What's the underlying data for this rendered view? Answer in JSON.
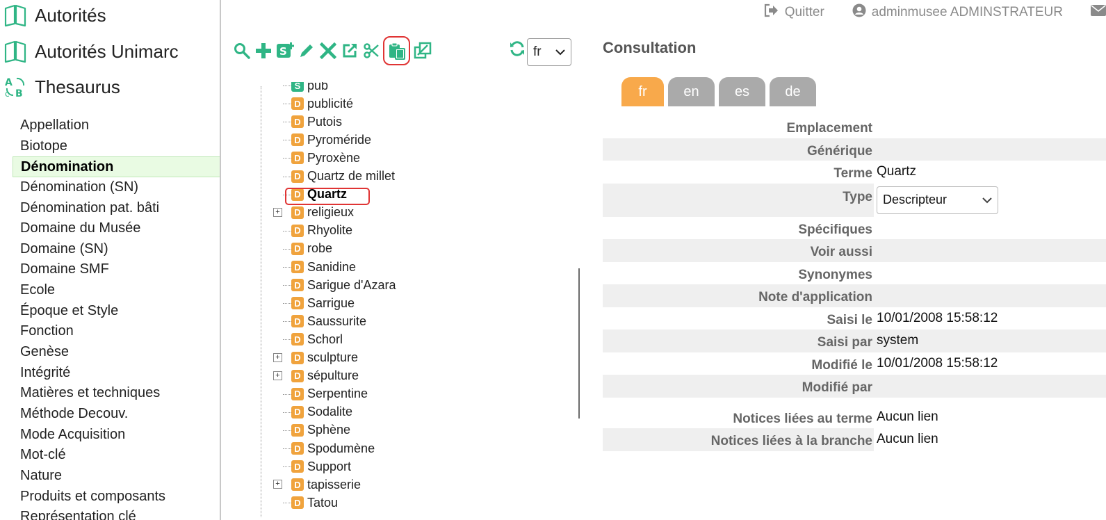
{
  "modules": [
    {
      "label": "Autorités",
      "icon": "book-icon"
    },
    {
      "label": "Autorités Unimarc",
      "icon": "book-icon"
    },
    {
      "label": "Thesaurus",
      "icon": "thesaurus-icon"
    }
  ],
  "categories": [
    "Appellation",
    "Biotope",
    "Dénomination",
    "Dénomination (SN)",
    "Dénomination pat. bâti",
    "Domaine du Musée",
    "Domaine (SN)",
    "Domaine SMF",
    "Ecole",
    "Époque et Style",
    "Fonction",
    "Genèse",
    "Intégrité",
    "Matières et techniques",
    "Méthode Decouv.",
    "Mode Acquisition",
    "Mot-clé",
    "Nature",
    "Produits et composants",
    "Représentation clé"
  ],
  "active_category": "Dénomination",
  "header": {
    "quit_label": "Quitter",
    "user_label": "adminmusee ADMINSTRATEUR"
  },
  "toolbar": {
    "icons": [
      "search-icon",
      "add-icon",
      "add-specific-icon",
      "edit-icon",
      "delete-icon",
      "open-external-icon",
      "cut-icon",
      "paste-icon",
      "link-icon"
    ],
    "highlighted": "paste-icon",
    "lang_value": "fr"
  },
  "tree": {
    "items": [
      {
        "label": "pub",
        "type": "S"
      },
      {
        "label": "publicité",
        "type": "D"
      },
      {
        "label": "Putois",
        "type": "D"
      },
      {
        "label": "Pyroméride",
        "type": "D"
      },
      {
        "label": "Pyroxène",
        "type": "D"
      },
      {
        "label": "Quartz de millet",
        "type": "D"
      },
      {
        "label": "Quartz",
        "type": "D",
        "selected": true
      },
      {
        "label": "religieux",
        "type": "D",
        "expandable": true
      },
      {
        "label": "Rhyolite",
        "type": "D"
      },
      {
        "label": "robe",
        "type": "D"
      },
      {
        "label": "Sanidine",
        "type": "D"
      },
      {
        "label": "Sarigue d'Azara",
        "type": "D"
      },
      {
        "label": "Sarrigue",
        "type": "D"
      },
      {
        "label": "Saussurite",
        "type": "D"
      },
      {
        "label": "Schorl",
        "type": "D"
      },
      {
        "label": "sculpture",
        "type": "D",
        "expandable": true
      },
      {
        "label": "sépulture",
        "type": "D",
        "expandable": true
      },
      {
        "label": "Serpentine",
        "type": "D"
      },
      {
        "label": "Sodalite",
        "type": "D"
      },
      {
        "label": "Sphène",
        "type": "D"
      },
      {
        "label": "Spodumène",
        "type": "D"
      },
      {
        "label": "Support",
        "type": "D"
      },
      {
        "label": "tapisserie",
        "type": "D",
        "expandable": true
      },
      {
        "label": "Tatou",
        "type": "D"
      }
    ]
  },
  "consultation": {
    "title": "Consultation",
    "tabs": [
      "fr",
      "en",
      "es",
      "de"
    ],
    "active_tab": "fr",
    "fields": {
      "emplacement": {
        "label": "Emplacement",
        "value": ""
      },
      "generique": {
        "label": "Générique",
        "value": ""
      },
      "terme": {
        "label": "Terme",
        "value": "Quartz"
      },
      "type": {
        "label": "Type",
        "value": "Descripteur"
      },
      "specifiques": {
        "label": "Spécifiques",
        "value": ""
      },
      "voir_aussi": {
        "label": "Voir aussi",
        "value": ""
      },
      "synonymes": {
        "label": "Synonymes",
        "value": ""
      },
      "note": {
        "label": "Note d'application",
        "value": ""
      },
      "saisi_le": {
        "label": "Saisi le",
        "value": "10/01/2008 15:58:12"
      },
      "saisi_par": {
        "label": "Saisi par",
        "value": "system"
      },
      "modifie_le": {
        "label": "Modifié le",
        "value": "10/01/2008 15:58:12"
      },
      "modifie_par": {
        "label": "Modifié par",
        "value": ""
      },
      "notices_terme": {
        "label": "Notices liées au terme",
        "value": "Aucun lien"
      },
      "notices_branche": {
        "label": "Notices liées à la branche",
        "value": "Aucun lien"
      }
    }
  },
  "colors": {
    "accent_green": "#2fb585",
    "descriptor_orange": "#f0a33d",
    "active_tab": "#f8a94b",
    "highlight_red": "#e03434"
  }
}
